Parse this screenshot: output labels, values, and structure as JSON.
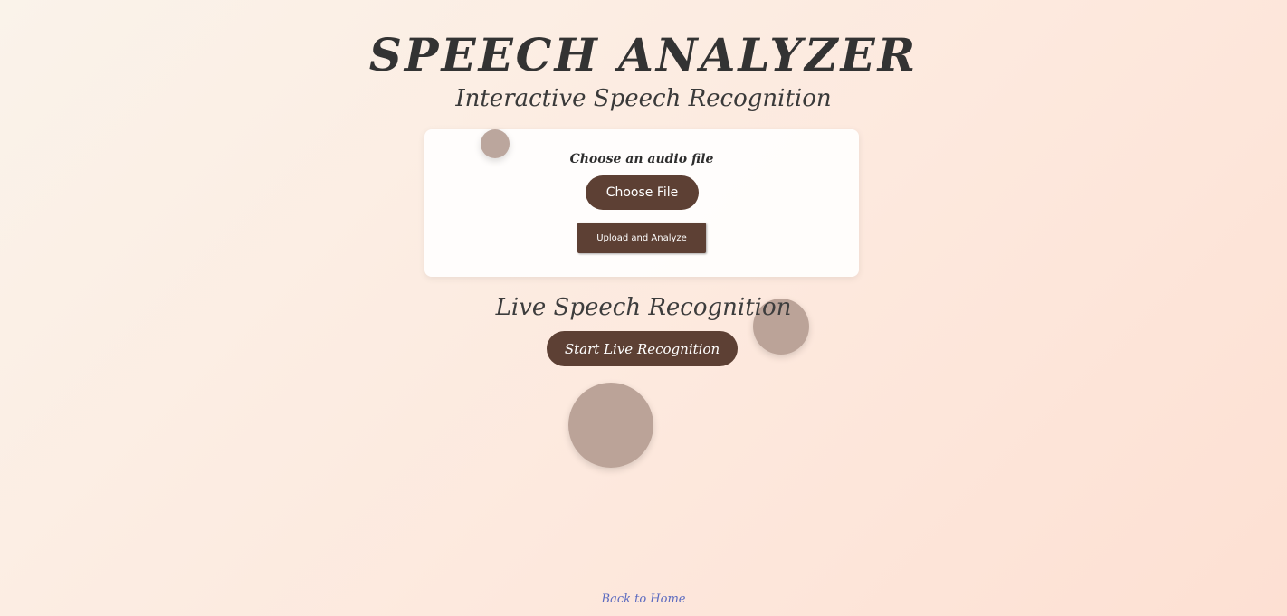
{
  "header": {
    "title": "SPEECH ANALYZER",
    "subtitle": "Interactive Speech Recognition"
  },
  "upload": {
    "label": "Choose an audio file",
    "choose_file_label": "Choose File",
    "submit_label": "Upload and Analyze"
  },
  "live": {
    "title": "Live Speech Recognition",
    "button_label": "Start Live Recognition"
  },
  "footer": {
    "home_link": "Back to Home"
  },
  "colors": {
    "button": "#5d4034",
    "link": "#5c6bc0",
    "bubble": "#af968c"
  }
}
